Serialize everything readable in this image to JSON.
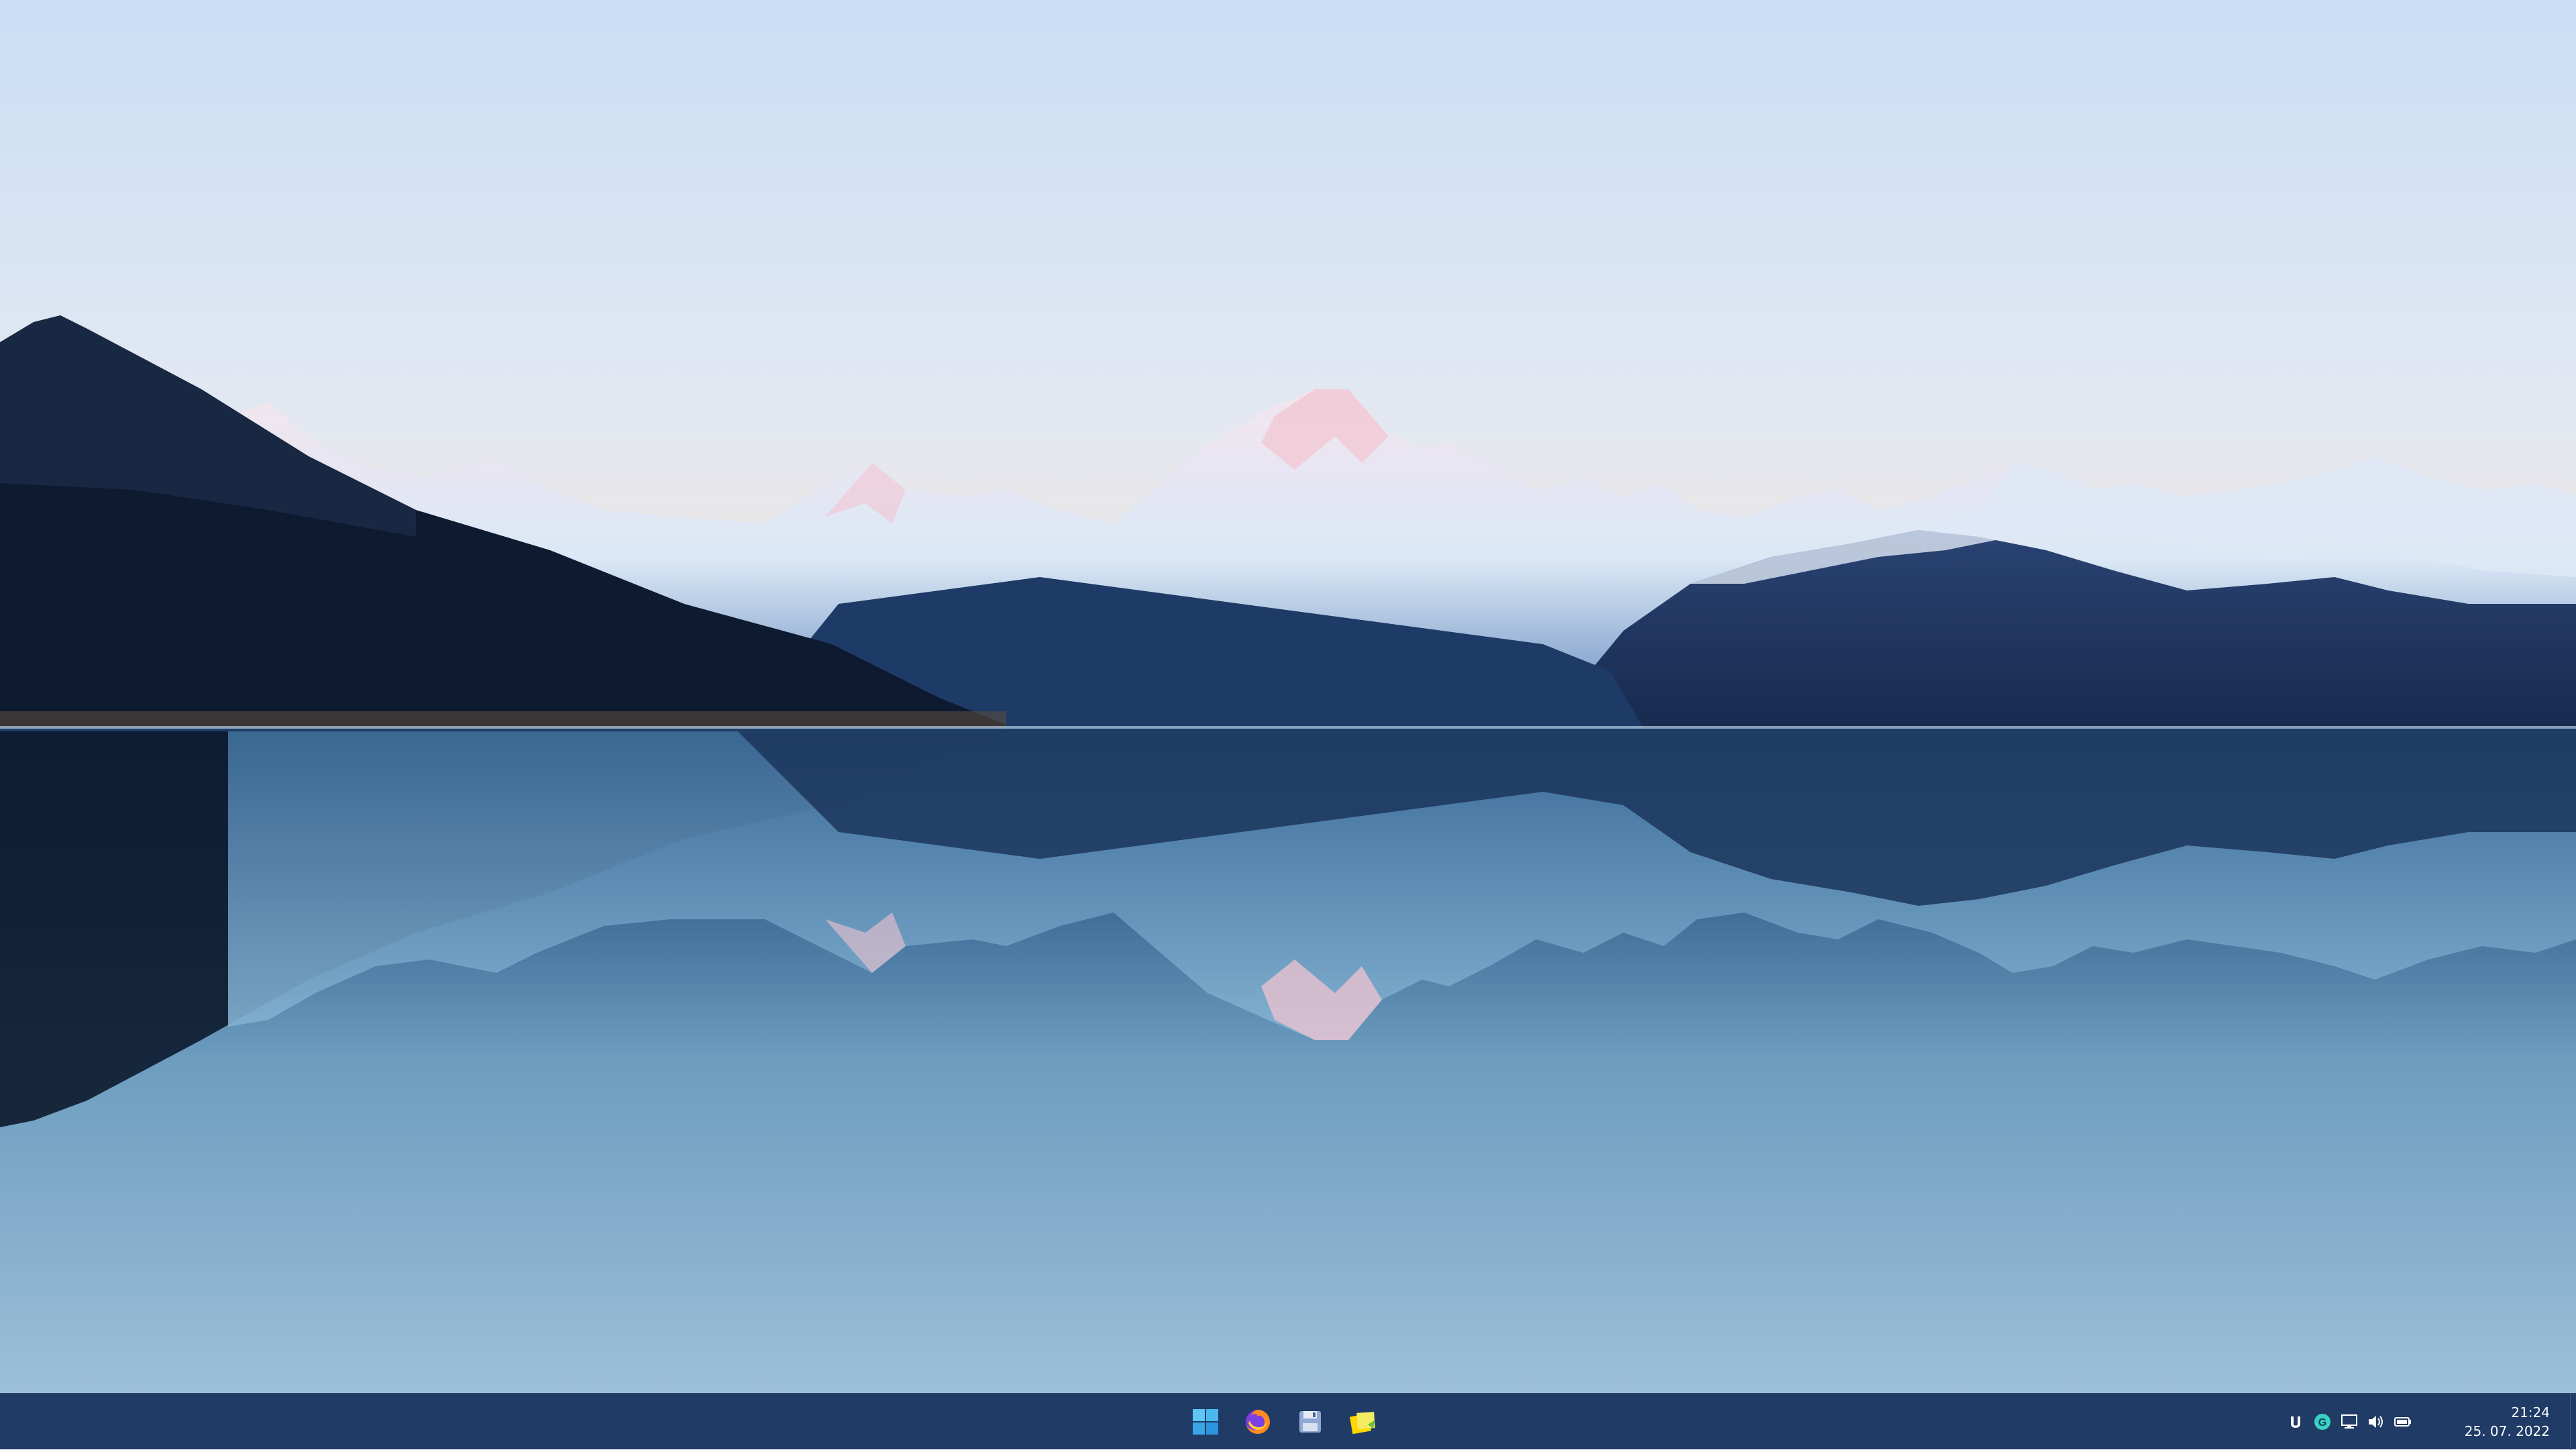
{
  "wallpaper": {
    "description_icon": "mountain-lake-wallpaper",
    "colors": {
      "sky_top": "#c9def5",
      "sky_mid": "#e2e8f2",
      "sky_horizon": "#f5e4d8",
      "far_mountains": "#8fb3d8",
      "snow": "#eef4fb",
      "snow_pink": "#f1c9d6",
      "dark_mountain": "#1b2e52",
      "left_ridge": "#0e1a30",
      "water_top": "#1e3d66",
      "water_mid": "#6d9dbf",
      "water_bottom": "#9dc0d8"
    }
  },
  "taskbar": {
    "background": "#1f3b66",
    "apps": [
      {
        "name": "start-button",
        "icon": "windows-logo-icon"
      },
      {
        "name": "firefox-button",
        "icon": "firefox-icon"
      },
      {
        "name": "save-app-button",
        "icon": "floppy-disk-icon"
      },
      {
        "name": "notes-app-button",
        "icon": "sticky-notes-icon"
      }
    ],
    "tray": {
      "icons": [
        "utorrent-icon",
        "update-badge-icon",
        "network-icon",
        "volume-icon",
        "battery-icon"
      ],
      "time": "21:24",
      "date": "25. 07. 2022"
    }
  }
}
